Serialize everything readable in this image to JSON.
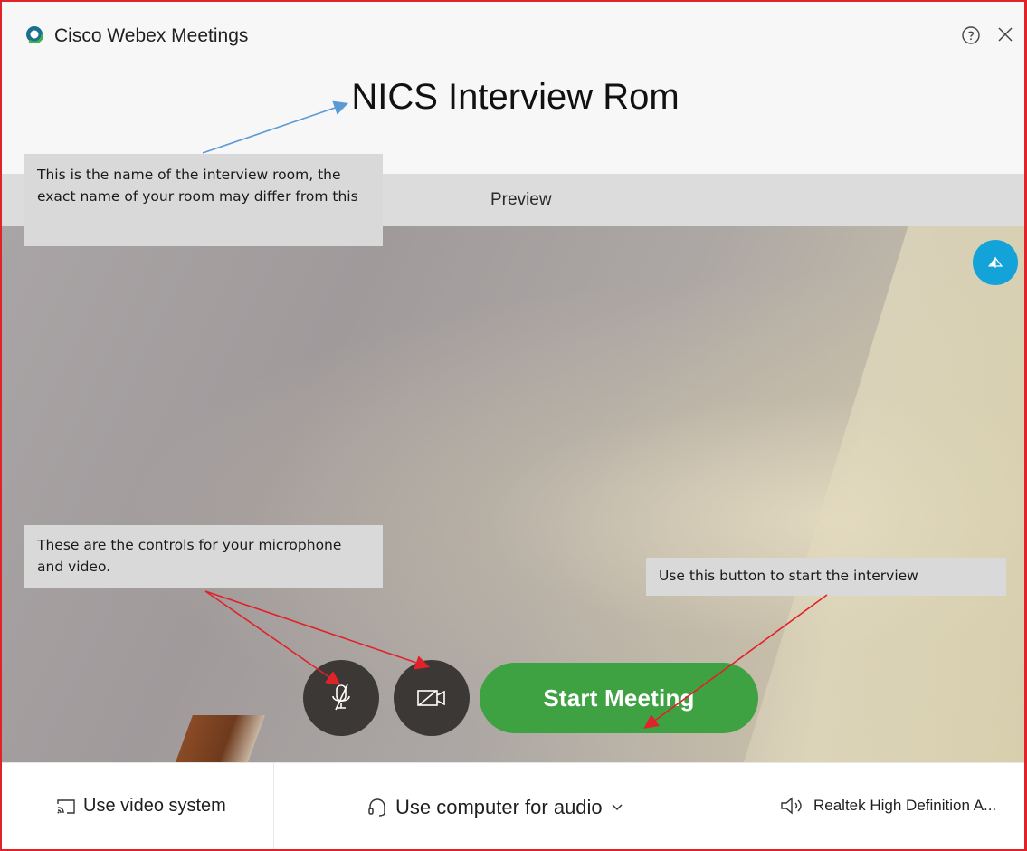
{
  "window": {
    "app_title": "Cisco Webex Meetings",
    "room_title": "NICS Interview Rom",
    "logo_icon": "webex-logo-icon",
    "help_icon": "help-circle-icon",
    "close_icon": "close-icon"
  },
  "preview": {
    "label": "Preview",
    "pip_icon": "self-view-icon"
  },
  "controls": {
    "mic_icon": "microphone-muted-icon",
    "video_icon": "video-off-icon",
    "start_label": "Start Meeting",
    "start_color": "#3ea142"
  },
  "annotations": {
    "room_note": "This is the name of the interview room, the exact name of your room may differ from this",
    "controls_note": "These are the controls for your microphone and video.",
    "start_note": "Use this button to start the interview"
  },
  "bottom_bar": {
    "video_system_label": "Use video system",
    "audio_label": "Use computer for audio",
    "speaker_label": "Realtek High Definition A..."
  },
  "colors": {
    "accent_blue": "#14a3d8",
    "annotation_arrow_red": "#e0222a",
    "annotation_arrow_blue": "#5b9bd5"
  }
}
